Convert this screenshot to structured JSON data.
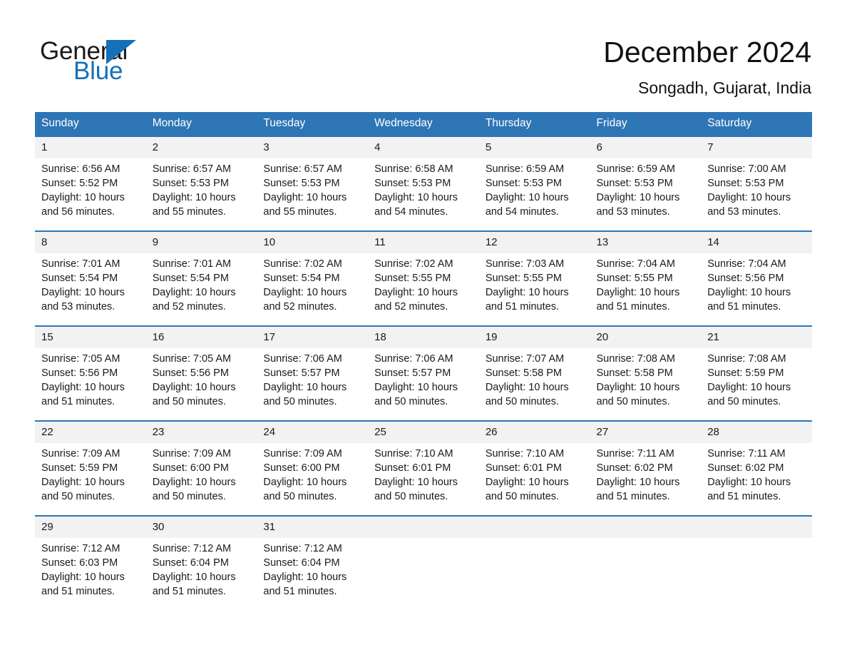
{
  "logo": {
    "word_top": "General",
    "word_bottom": "Blue",
    "triangle_color": "#1470b8",
    "text_color": "#1a1a1a"
  },
  "header": {
    "title": "December 2024",
    "subtitle": "Songadh, Gujarat, India"
  },
  "theme": {
    "header_blue": "#2e75b6",
    "daynum_band": "#f2f2f2",
    "text": "#1a1a1a"
  },
  "weekday_headers": [
    "Sunday",
    "Monday",
    "Tuesday",
    "Wednesday",
    "Thursday",
    "Friday",
    "Saturday"
  ],
  "weeks": [
    {
      "days": [
        {
          "num": "1",
          "sunrise": "Sunrise: 6:56 AM",
          "sunset": "Sunset: 5:52 PM",
          "daylight_line1": "Daylight: 10 hours",
          "daylight_line2": "and 56 minutes."
        },
        {
          "num": "2",
          "sunrise": "Sunrise: 6:57 AM",
          "sunset": "Sunset: 5:53 PM",
          "daylight_line1": "Daylight: 10 hours",
          "daylight_line2": "and 55 minutes."
        },
        {
          "num": "3",
          "sunrise": "Sunrise: 6:57 AM",
          "sunset": "Sunset: 5:53 PM",
          "daylight_line1": "Daylight: 10 hours",
          "daylight_line2": "and 55 minutes."
        },
        {
          "num": "4",
          "sunrise": "Sunrise: 6:58 AM",
          "sunset": "Sunset: 5:53 PM",
          "daylight_line1": "Daylight: 10 hours",
          "daylight_line2": "and 54 minutes."
        },
        {
          "num": "5",
          "sunrise": "Sunrise: 6:59 AM",
          "sunset": "Sunset: 5:53 PM",
          "daylight_line1": "Daylight: 10 hours",
          "daylight_line2": "and 54 minutes."
        },
        {
          "num": "6",
          "sunrise": "Sunrise: 6:59 AM",
          "sunset": "Sunset: 5:53 PM",
          "daylight_line1": "Daylight: 10 hours",
          "daylight_line2": "and 53 minutes."
        },
        {
          "num": "7",
          "sunrise": "Sunrise: 7:00 AM",
          "sunset": "Sunset: 5:53 PM",
          "daylight_line1": "Daylight: 10 hours",
          "daylight_line2": "and 53 minutes."
        }
      ]
    },
    {
      "days": [
        {
          "num": "8",
          "sunrise": "Sunrise: 7:01 AM",
          "sunset": "Sunset: 5:54 PM",
          "daylight_line1": "Daylight: 10 hours",
          "daylight_line2": "and 53 minutes."
        },
        {
          "num": "9",
          "sunrise": "Sunrise: 7:01 AM",
          "sunset": "Sunset: 5:54 PM",
          "daylight_line1": "Daylight: 10 hours",
          "daylight_line2": "and 52 minutes."
        },
        {
          "num": "10",
          "sunrise": "Sunrise: 7:02 AM",
          "sunset": "Sunset: 5:54 PM",
          "daylight_line1": "Daylight: 10 hours",
          "daylight_line2": "and 52 minutes."
        },
        {
          "num": "11",
          "sunrise": "Sunrise: 7:02 AM",
          "sunset": "Sunset: 5:55 PM",
          "daylight_line1": "Daylight: 10 hours",
          "daylight_line2": "and 52 minutes."
        },
        {
          "num": "12",
          "sunrise": "Sunrise: 7:03 AM",
          "sunset": "Sunset: 5:55 PM",
          "daylight_line1": "Daylight: 10 hours",
          "daylight_line2": "and 51 minutes."
        },
        {
          "num": "13",
          "sunrise": "Sunrise: 7:04 AM",
          "sunset": "Sunset: 5:55 PM",
          "daylight_line1": "Daylight: 10 hours",
          "daylight_line2": "and 51 minutes."
        },
        {
          "num": "14",
          "sunrise": "Sunrise: 7:04 AM",
          "sunset": "Sunset: 5:56 PM",
          "daylight_line1": "Daylight: 10 hours",
          "daylight_line2": "and 51 minutes."
        }
      ]
    },
    {
      "days": [
        {
          "num": "15",
          "sunrise": "Sunrise: 7:05 AM",
          "sunset": "Sunset: 5:56 PM",
          "daylight_line1": "Daylight: 10 hours",
          "daylight_line2": "and 51 minutes."
        },
        {
          "num": "16",
          "sunrise": "Sunrise: 7:05 AM",
          "sunset": "Sunset: 5:56 PM",
          "daylight_line1": "Daylight: 10 hours",
          "daylight_line2": "and 50 minutes."
        },
        {
          "num": "17",
          "sunrise": "Sunrise: 7:06 AM",
          "sunset": "Sunset: 5:57 PM",
          "daylight_line1": "Daylight: 10 hours",
          "daylight_line2": "and 50 minutes."
        },
        {
          "num": "18",
          "sunrise": "Sunrise: 7:06 AM",
          "sunset": "Sunset: 5:57 PM",
          "daylight_line1": "Daylight: 10 hours",
          "daylight_line2": "and 50 minutes."
        },
        {
          "num": "19",
          "sunrise": "Sunrise: 7:07 AM",
          "sunset": "Sunset: 5:58 PM",
          "daylight_line1": "Daylight: 10 hours",
          "daylight_line2": "and 50 minutes."
        },
        {
          "num": "20",
          "sunrise": "Sunrise: 7:08 AM",
          "sunset": "Sunset: 5:58 PM",
          "daylight_line1": "Daylight: 10 hours",
          "daylight_line2": "and 50 minutes."
        },
        {
          "num": "21",
          "sunrise": "Sunrise: 7:08 AM",
          "sunset": "Sunset: 5:59 PM",
          "daylight_line1": "Daylight: 10 hours",
          "daylight_line2": "and 50 minutes."
        }
      ]
    },
    {
      "days": [
        {
          "num": "22",
          "sunrise": "Sunrise: 7:09 AM",
          "sunset": "Sunset: 5:59 PM",
          "daylight_line1": "Daylight: 10 hours",
          "daylight_line2": "and 50 minutes."
        },
        {
          "num": "23",
          "sunrise": "Sunrise: 7:09 AM",
          "sunset": "Sunset: 6:00 PM",
          "daylight_line1": "Daylight: 10 hours",
          "daylight_line2": "and 50 minutes."
        },
        {
          "num": "24",
          "sunrise": "Sunrise: 7:09 AM",
          "sunset": "Sunset: 6:00 PM",
          "daylight_line1": "Daylight: 10 hours",
          "daylight_line2": "and 50 minutes."
        },
        {
          "num": "25",
          "sunrise": "Sunrise: 7:10 AM",
          "sunset": "Sunset: 6:01 PM",
          "daylight_line1": "Daylight: 10 hours",
          "daylight_line2": "and 50 minutes."
        },
        {
          "num": "26",
          "sunrise": "Sunrise: 7:10 AM",
          "sunset": "Sunset: 6:01 PM",
          "daylight_line1": "Daylight: 10 hours",
          "daylight_line2": "and 50 minutes."
        },
        {
          "num": "27",
          "sunrise": "Sunrise: 7:11 AM",
          "sunset": "Sunset: 6:02 PM",
          "daylight_line1": "Daylight: 10 hours",
          "daylight_line2": "and 51 minutes."
        },
        {
          "num": "28",
          "sunrise": "Sunrise: 7:11 AM",
          "sunset": "Sunset: 6:02 PM",
          "daylight_line1": "Daylight: 10 hours",
          "daylight_line2": "and 51 minutes."
        }
      ]
    },
    {
      "days": [
        {
          "num": "29",
          "sunrise": "Sunrise: 7:12 AM",
          "sunset": "Sunset: 6:03 PM",
          "daylight_line1": "Daylight: 10 hours",
          "daylight_line2": "and 51 minutes."
        },
        {
          "num": "30",
          "sunrise": "Sunrise: 7:12 AM",
          "sunset": "Sunset: 6:04 PM",
          "daylight_line1": "Daylight: 10 hours",
          "daylight_line2": "and 51 minutes."
        },
        {
          "num": "31",
          "sunrise": "Sunrise: 7:12 AM",
          "sunset": "Sunset: 6:04 PM",
          "daylight_line1": "Daylight: 10 hours",
          "daylight_line2": "and 51 minutes."
        },
        {
          "num": "",
          "sunrise": "",
          "sunset": "",
          "daylight_line1": "",
          "daylight_line2": ""
        },
        {
          "num": "",
          "sunrise": "",
          "sunset": "",
          "daylight_line1": "",
          "daylight_line2": ""
        },
        {
          "num": "",
          "sunrise": "",
          "sunset": "",
          "daylight_line1": "",
          "daylight_line2": ""
        },
        {
          "num": "",
          "sunrise": "",
          "sunset": "",
          "daylight_line1": "",
          "daylight_line2": ""
        }
      ]
    }
  ]
}
